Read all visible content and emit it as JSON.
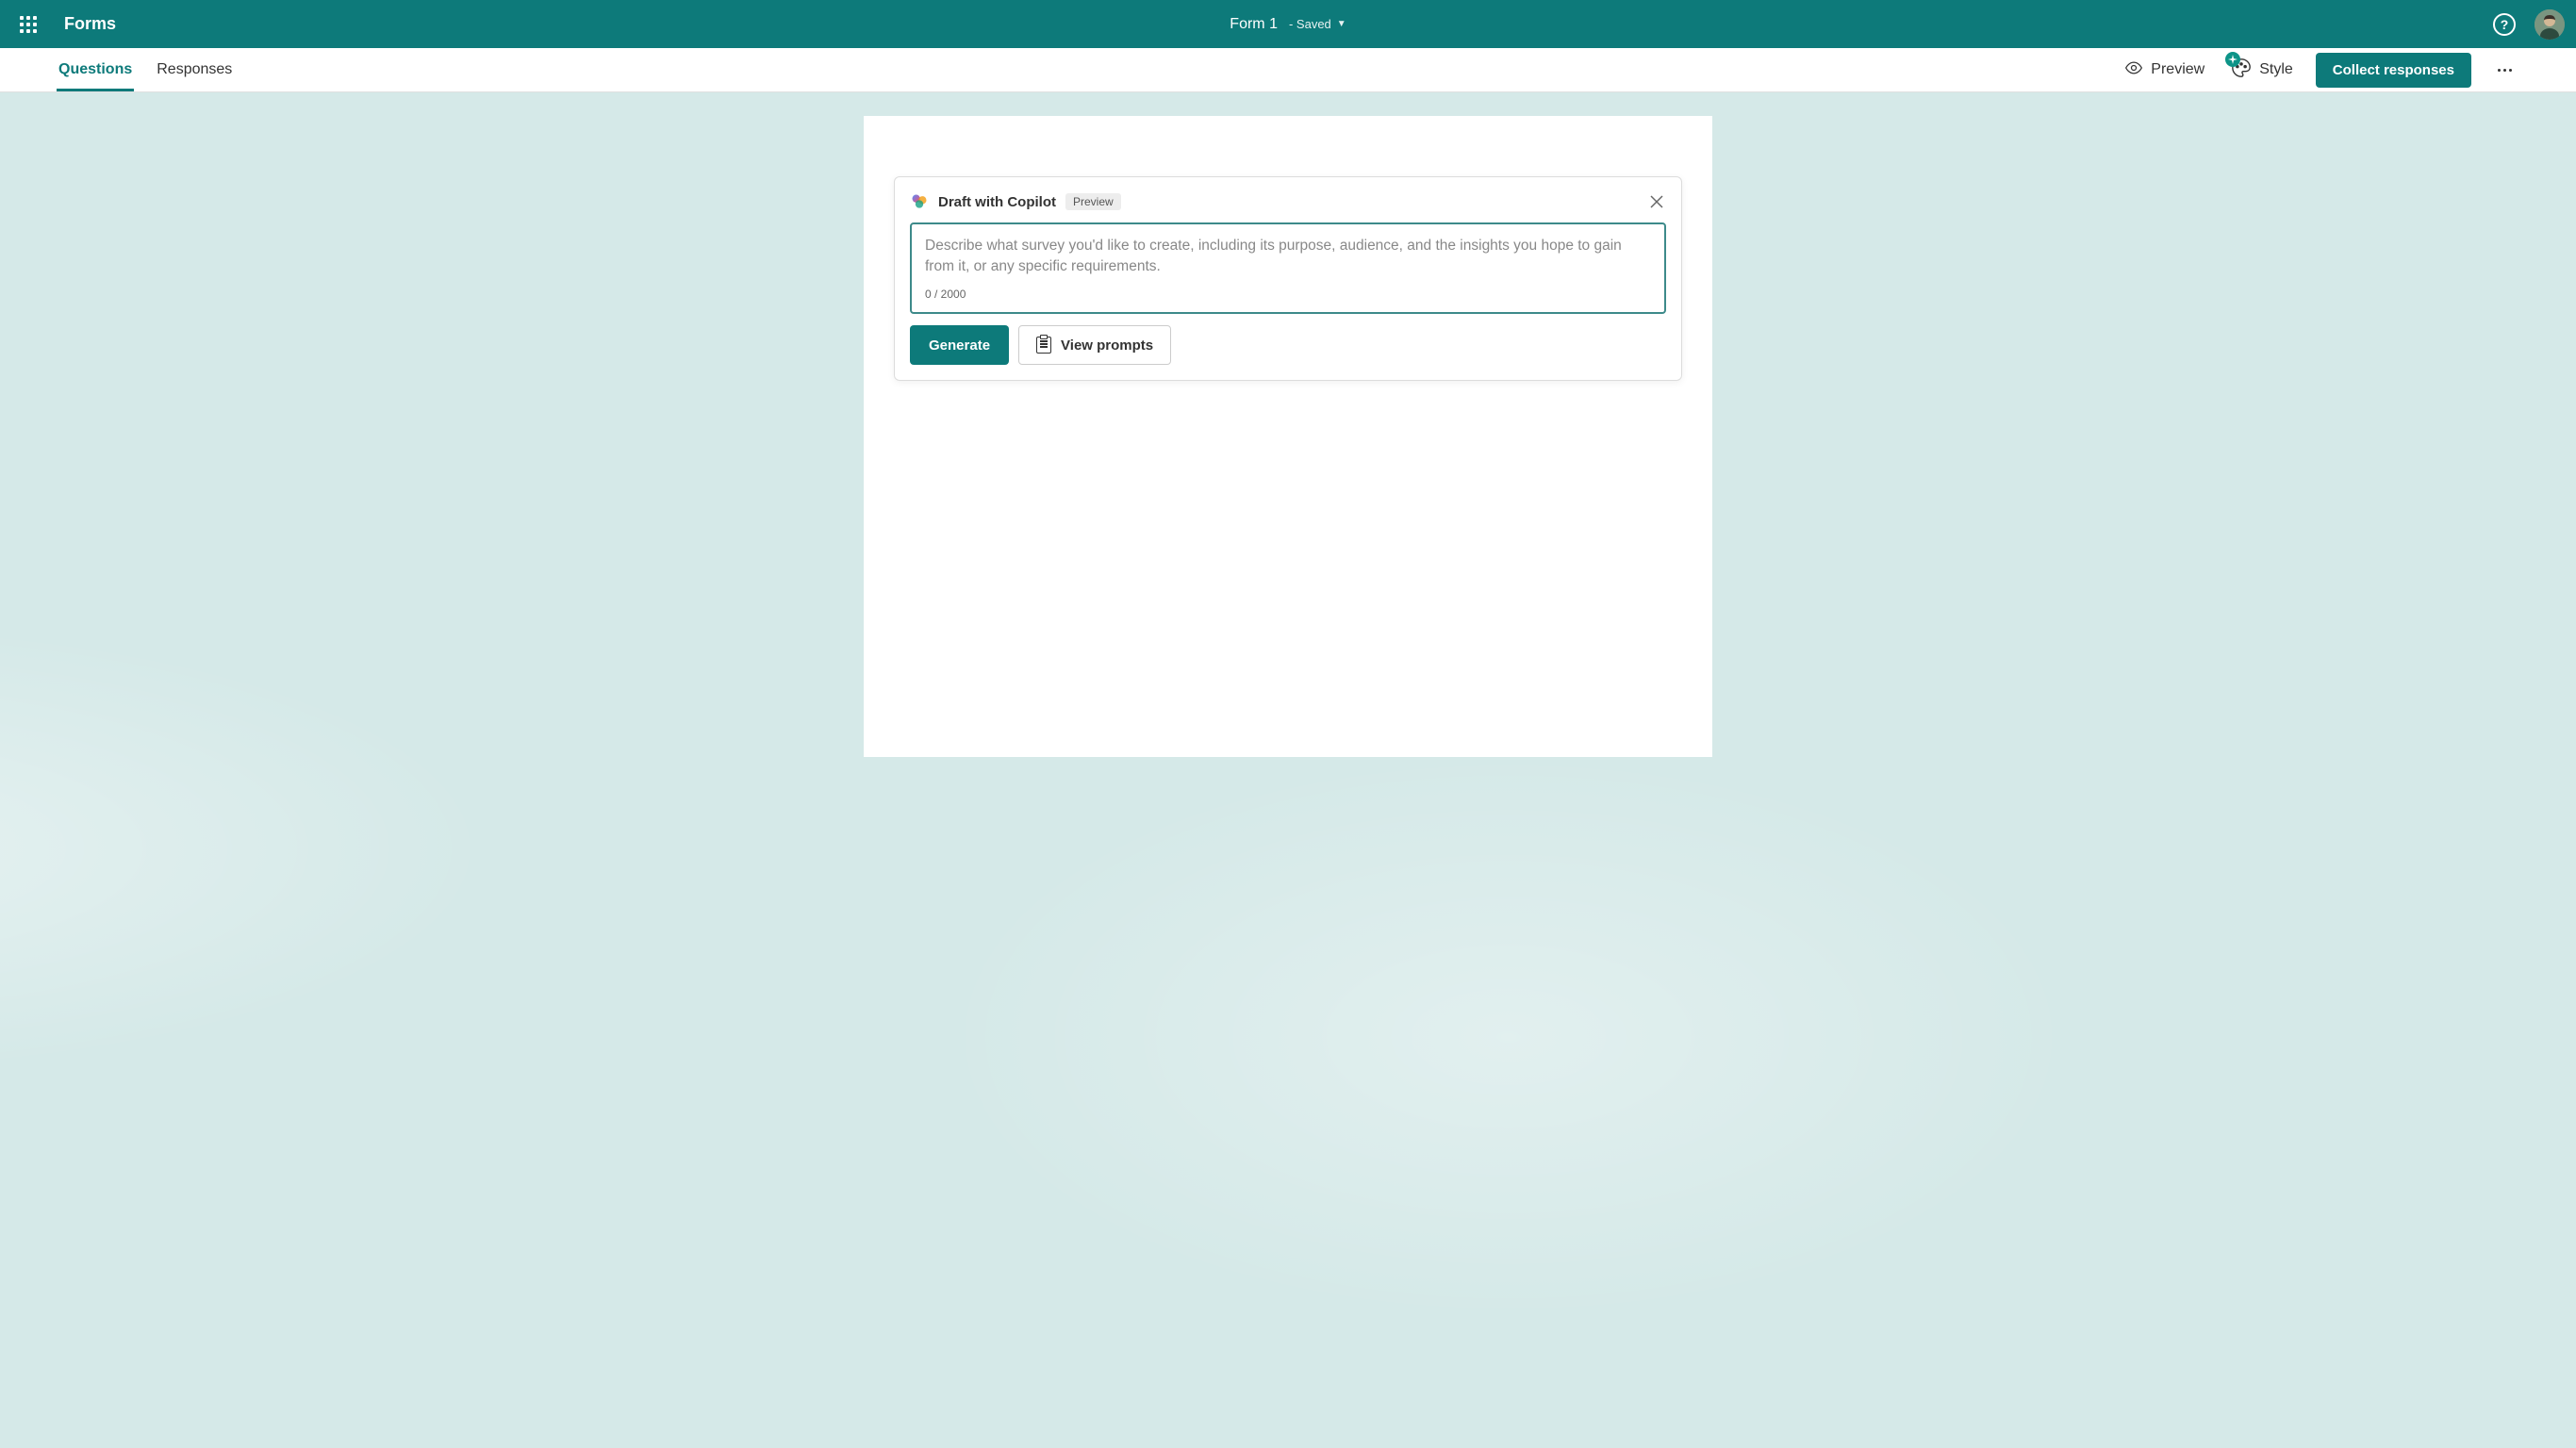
{
  "header": {
    "app_name": "Forms",
    "form_title": "Form 1",
    "save_status": "- Saved"
  },
  "tabs": {
    "questions": "Questions",
    "responses": "Responses"
  },
  "toolbar": {
    "preview": "Preview",
    "style": "Style",
    "collect": "Collect responses"
  },
  "copilot": {
    "title": "Draft with Copilot",
    "badge": "Preview",
    "placeholder": "Describe what survey you'd like to create, including its purpose, audience, and the insights you hope to gain from it, or any specific requirements.",
    "char_count": "0 / 2000",
    "generate": "Generate",
    "view_prompts": "View prompts"
  },
  "colors": {
    "primary": "#0d7a7a",
    "background": "#d5e9e8"
  }
}
